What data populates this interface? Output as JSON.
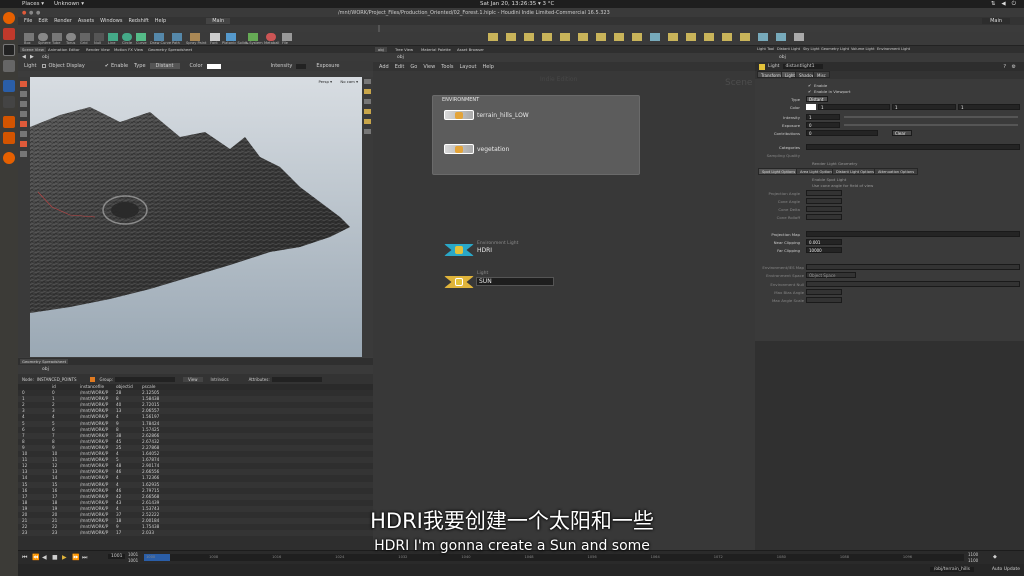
{
  "os": {
    "places": "Places ▾",
    "app": "Unknown ▾",
    "datetime": "Sat Jan 20, 13:26:35 ▾",
    "temp": "3 °C"
  },
  "window": {
    "title": "/mnt/WORK/Project_Files/Production_Oriented/02_Forest.1.hiplc - Houdini Indie Limited-Commercial 16.5.323",
    "desktop": "Main"
  },
  "menu": [
    "File",
    "Edit",
    "Render",
    "Assets",
    "Windows",
    "Redshift",
    "Help"
  ],
  "main_tab": "Main",
  "shelf": [
    "Box",
    "Sphere",
    "Tube",
    "Torus",
    "Grid",
    "Null",
    "Line",
    "Circle",
    "Curve",
    "Draw Curve",
    "Path",
    "Spray Paint",
    "Font",
    "Platonic Solids",
    "L-System",
    "Metaball",
    "File"
  ],
  "viewport": {
    "tabs": [
      "Scene View",
      "Animation Editor",
      "Render View",
      "Motion FX View",
      "Geometry Spreadsheet"
    ],
    "path": "obj",
    "toolbar": {
      "node": "Light",
      "object_display": "Object Display",
      "enable": "Enable",
      "type_label": "Type",
      "type_value": "Distant",
      "color_label": "Color",
      "intensity_label": "Intensity",
      "exposure_label": "Exposure"
    },
    "persp": "Persp ▾",
    "nocam": "No cam ▾"
  },
  "spreadsheet": {
    "tab": "Geometry Spreadsheet",
    "path": "obj",
    "node_label": "Node:",
    "node_value": "INSTANCED_POINTS",
    "group_label": "Group:",
    "view_label": "View",
    "intrinsics": "Intrinsics",
    "attributes": "Attributes:",
    "columns": [
      "",
      "id",
      "instancefile",
      "objectid",
      "pscale"
    ],
    "rows": [
      [
        "0",
        "0",
        "/mnt/WORK/P",
        "28",
        "2.12505"
      ],
      [
        "1",
        "1",
        "/mnt/WORK/P",
        "8",
        "1.58438"
      ],
      [
        "2",
        "2",
        "/mnt/WORK/P",
        "40",
        "2.72015"
      ],
      [
        "3",
        "3",
        "/mnt/WORK/P",
        "13",
        "2.06557"
      ],
      [
        "4",
        "4",
        "/mnt/WORK/P",
        "4",
        "1.56197"
      ],
      [
        "5",
        "5",
        "/mnt/WORK/P",
        "9",
        "1.78424"
      ],
      [
        "6",
        "6",
        "/mnt/WORK/P",
        "8",
        "1.57425"
      ],
      [
        "7",
        "7",
        "/mnt/WORK/P",
        "38",
        "2.62866"
      ],
      [
        "8",
        "8",
        "/mnt/WORK/P",
        "45",
        "2.67432"
      ],
      [
        "9",
        "9",
        "/mnt/WORK/P",
        "25",
        "2.27868"
      ],
      [
        "10",
        "10",
        "/mnt/WORK/P",
        "4",
        "1.64052"
      ],
      [
        "11",
        "11",
        "/mnt/WORK/P",
        "5",
        "1.67874"
      ],
      [
        "12",
        "12",
        "/mnt/WORK/P",
        "48",
        "2.90174"
      ],
      [
        "13",
        "13",
        "/mnt/WORK/P",
        "46",
        "2.66556"
      ],
      [
        "14",
        "14",
        "/mnt/WORK/P",
        "4",
        "1.72366"
      ],
      [
        "15",
        "15",
        "/mnt/WORK/P",
        "4",
        "1.62935"
      ],
      [
        "16",
        "16",
        "/mnt/WORK/P",
        "46",
        "2.79715"
      ],
      [
        "17",
        "17",
        "/mnt/WORK/P",
        "42",
        "2.66568"
      ],
      [
        "18",
        "18",
        "/mnt/WORK/P",
        "43",
        "2.61439"
      ],
      [
        "19",
        "19",
        "/mnt/WORK/P",
        "4",
        "1.53743"
      ],
      [
        "20",
        "20",
        "/mnt/WORK/P",
        "37",
        "2.52222"
      ],
      [
        "21",
        "21",
        "/mnt/WORK/P",
        "18",
        "2.00184"
      ],
      [
        "22",
        "22",
        "/mnt/WORK/P",
        "9",
        "1.75438"
      ],
      [
        "23",
        "23",
        "/mnt/WORK/P",
        "17",
        "2.033"
      ]
    ]
  },
  "network": {
    "tabs": [
      "obj",
      "Tree View",
      "Material Palette",
      "Asset Browser"
    ],
    "path": "obj",
    "menu": [
      "Add",
      "Edit",
      "Go",
      "View",
      "Tools",
      "Layout",
      "Help"
    ],
    "indie": "Indie Edition",
    "scene": "Scene",
    "env_box": "ENVIRONMENT",
    "nodes": [
      {
        "label": "terrain_hills_LOW"
      },
      {
        "label": "vegetation"
      },
      {
        "type": "Environment Light",
        "label": "HDRI"
      },
      {
        "type": "Light",
        "label": "SUN"
      }
    ]
  },
  "params": {
    "tabs": [
      "Light Tool",
      "Distant Light",
      "Sky Light",
      "Geometry Light",
      "Volume Light",
      "Environment Light"
    ],
    "path": "obj",
    "node_type": "Light",
    "node_name": "distantlight1",
    "subtabs": [
      "Transform",
      "Light",
      "Shadow",
      "Misc"
    ],
    "enable": "Enable",
    "enable_viewport": "Enable in Viewport",
    "type_label": "Type",
    "type_value": "Distant",
    "color_label": "Color",
    "color_values": [
      "1",
      "1",
      "1"
    ],
    "intensity_label": "Intensity",
    "intensity_value": "1",
    "exposure_label": "Exposure",
    "exposure_value": "0",
    "contributions_label": "Contributions",
    "contributions_value": "0",
    "contrib_btn": "Clear",
    "categories_label": "Categories",
    "sampling_label": "Sampling Quality",
    "render_geom": "Render Light Geometry",
    "light_tabs": [
      "Spot Light Options",
      "Area Light Options",
      "Distant Light Options",
      "Attenuation Options"
    ],
    "enable_spot": "Enable Spot Light",
    "use_cone": "Use cone angle for field of view",
    "projection_angle": "Projection Angle",
    "cone_angle": "Cone Angle",
    "cone_delta": "Cone Delta",
    "cone_rolloff": "Cone Rolloff",
    "projection_map": "Projection Map",
    "near_clip": "Near Clipping",
    "near_value": "0.001",
    "far_clip": "Far Clipping",
    "far_value": "10000",
    "env_map": "Environment/IES Map",
    "env_space": "Environment Space",
    "env_space_value": "Object Space",
    "env_null": "Environment Null",
    "max_bias": "Max Bias Angle",
    "max_scale": "Max Angle Scale"
  },
  "timeline": {
    "frame": "1001",
    "start": "1001",
    "end": "1100",
    "end2": "1100",
    "ticks": [
      "1000",
      "1008",
      "1016",
      "1024",
      "1032",
      "1040",
      "1048",
      "1056",
      "1064",
      "1072",
      "1080",
      "1088",
      "1096"
    ]
  },
  "status": {
    "path": "/obj/terrain_hills",
    "auto": "Auto Update"
  },
  "subtitles": {
    "zh": "HDRI我要创建一个太阳和一些",
    "en": "HDRI I'm gonna create a Sun and some"
  }
}
